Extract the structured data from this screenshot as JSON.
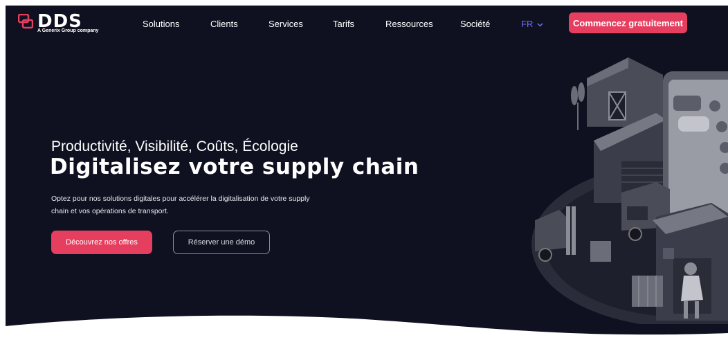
{
  "brand": {
    "name": "DDS",
    "tagline": "A Generix Group company",
    "accent": "#e63e5f"
  },
  "nav": {
    "items": [
      "Solutions",
      "Clients",
      "Services",
      "Tarifs",
      "Ressources",
      "Société"
    ],
    "language": "FR",
    "cta_label": "Commencez gratuitement"
  },
  "hero": {
    "kicker": "Productivité, Visibilité, Coûts, Écologie",
    "title": "Digitalisez votre supply chain",
    "description": "Optez pour nos solutions digitales pour accélérer la digitalisation de votre supply chain et vos opérations de transport.",
    "primary_button": "Découvrez nos offres",
    "secondary_button": "Réserver une démo"
  },
  "colors": {
    "background": "#0f1120",
    "accent": "#e63e5f",
    "language": "#6d6ef5"
  }
}
